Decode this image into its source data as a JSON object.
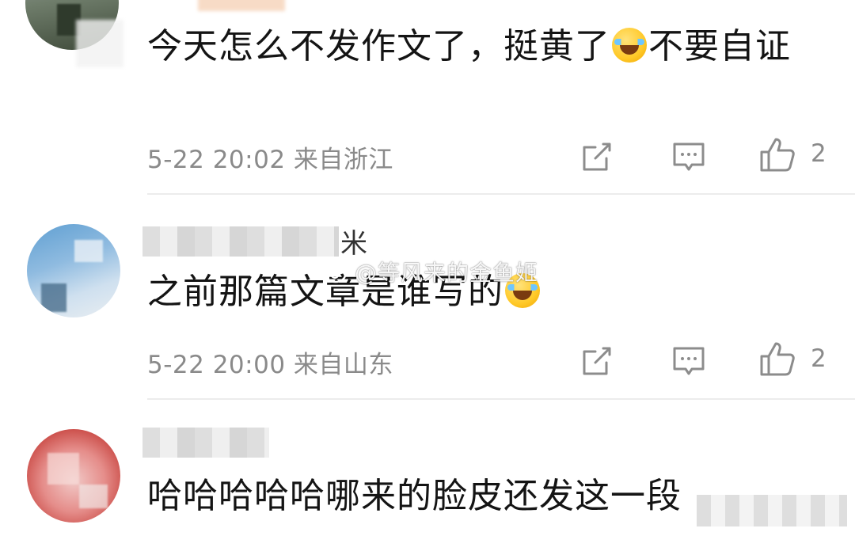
{
  "comments": [
    {
      "text_before_emoji": "今天怎么不发作文了，挺黄了",
      "text_after_emoji": "不要自证",
      "time": "5-22 20:02",
      "location": "来自浙江",
      "likes": "2",
      "emoji_icon": "laugh-cry-emoji-icon"
    },
    {
      "username_fragment": "米",
      "text_before_emoji": "之前那篇文章是谁写的",
      "time": "5-22 20:00",
      "location": "来自山东",
      "likes": "2",
      "emoji_icon": "loud-cry-emoji-icon"
    },
    {
      "text": "哈哈哈哈哈哪来的脸皮还发这一段"
    }
  ],
  "watermark": {
    "text": "@等风来的金鱼姬",
    "icon": "weibo-logo-icon"
  },
  "colors": {
    "meta_text": "#8a8a8a",
    "comment_text": "#141414",
    "divider": "#ececec",
    "icon_stroke": "#8c8c8c"
  }
}
